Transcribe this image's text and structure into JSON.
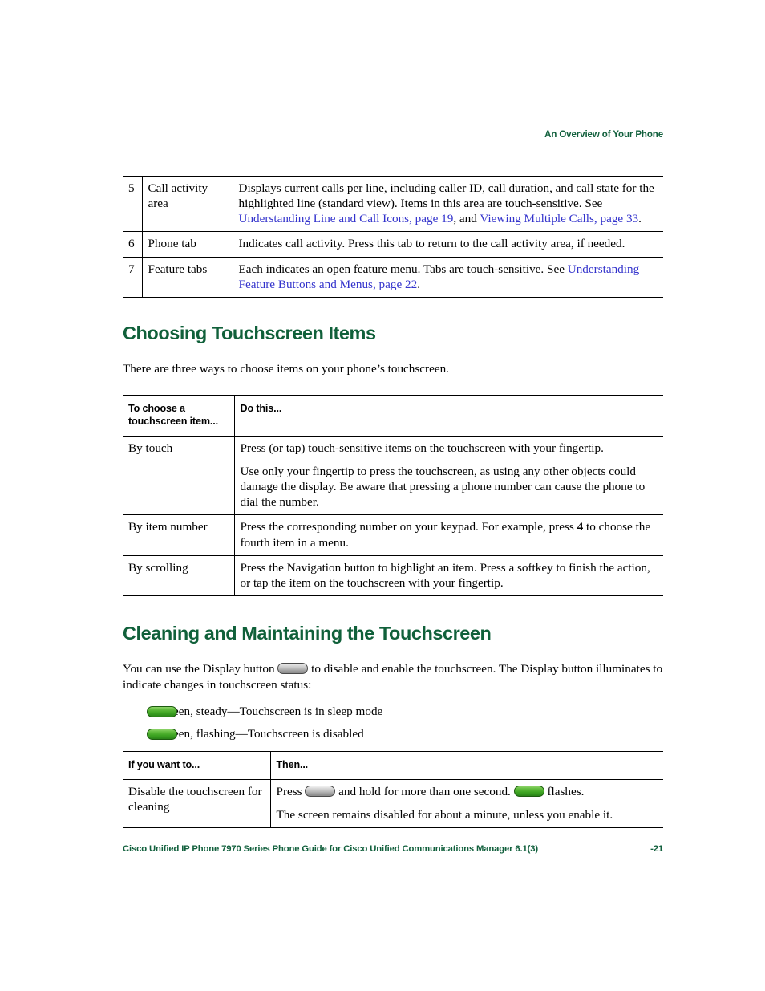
{
  "header": {
    "running_head": "An Overview of Your Phone"
  },
  "table_overview": {
    "rows": [
      {
        "number": "5",
        "label": "Call activity area",
        "description_parts": [
          {
            "type": "text",
            "value": "Displays current calls per line, including caller ID, call duration, and call state for the highlighted line (standard view). Items in this area are touch-sensitive. See "
          },
          {
            "type": "link",
            "value": "Understanding Line and Call Icons, page 19"
          },
          {
            "type": "text",
            "value": ", and "
          },
          {
            "type": "link",
            "value": "Viewing Multiple Calls, page 33"
          },
          {
            "type": "text",
            "value": "."
          }
        ]
      },
      {
        "number": "6",
        "label": "Phone tab",
        "description_parts": [
          {
            "type": "text",
            "value": "Indicates call activity. Press this tab to return to the call activity area, if needed."
          }
        ]
      },
      {
        "number": "7",
        "label": "Feature tabs",
        "description_parts": [
          {
            "type": "text",
            "value": "Each indicates an open feature menu. Tabs are touch-sensitive. See "
          },
          {
            "type": "link",
            "value": "Understanding Feature Buttons and Menus, page 22"
          },
          {
            "type": "text",
            "value": "."
          }
        ]
      }
    ],
    "row5_desc_text": "Displays current calls per line, including caller ID, call duration, and call state for the highlighted line (standard view). Items in this area are touch-sensitive. See ",
    "row5_link1": "Understanding Line and Call Icons, page 19",
    "row5_mid": ", and ",
    "row5_link2": "Viewing Multiple Calls, page 33",
    "row5_end": ".",
    "row6_desc": "Indicates call activity. Press this tab to return to the call activity area, if needed.",
    "row7_desc_text": "Each indicates an open feature menu. Tabs are touch-sensitive. See ",
    "row7_link1": "Understanding Feature Buttons and Menus, page 22",
    "row7_end": "."
  },
  "section_choosing": {
    "heading": "Choosing Touchscreen Items",
    "intro": "There are three ways to choose items on your phone’s touchscreen.",
    "table": {
      "header_col1": "To choose a touchscreen item...",
      "header_col2": "Do this...",
      "rows": [
        {
          "method": "By touch",
          "para1": "Press (or tap) touch-sensitive items on the touchscreen with your fingertip.",
          "para2": "Use only your fingertip to press the touchscreen, as using any other objects could damage the display. Be aware that pressing a phone number can cause the phone to dial the number."
        },
        {
          "method": "By item number",
          "para1_pre": "Press the corresponding number on your keypad. For example, press ",
          "para1_bold": "4",
          "para1_post": " to choose the fourth item in a menu."
        },
        {
          "method": "By scrolling",
          "para1": "Press the Navigation button to highlight an item. Press a softkey to finish the action, or tap the item on the touchscreen with your fingertip."
        }
      ]
    }
  },
  "section_cleaning": {
    "heading": "Cleaning and Maintaining the Touchscreen",
    "intro_pre": "You can use the Display button ",
    "intro_post": " to disable and enable the touchscreen. The Display button illuminates to indicate changes in touchscreen status:",
    "status_items": [
      {
        "icon": "green-pill-icon",
        "text": "Green, steady—Touchscreen is in sleep mode"
      },
      {
        "icon": "green-pill-icon",
        "text": "Green, flashing—Touchscreen is disabled"
      }
    ],
    "table": {
      "header_col1": "If you want to...",
      "header_col2": "Then...",
      "row": {
        "want_to": "Disable the touchscreen for cleaning",
        "then_pre": "Press ",
        "then_mid": " and hold for more than one second. ",
        "then_post": " flashes.",
        "then_para2": "The screen remains disabled for about a minute, unless you enable it."
      }
    }
  },
  "footer": {
    "left": "Cisco Unified IP Phone 7970 Series Phone Guide for Cisco Unified Communications Manager 6.1(3)",
    "right": "-21"
  },
  "colors": {
    "heading_green": "#10603A",
    "link_blue": "#3333CC",
    "pill_green": "#3FA523",
    "pill_gray": "#B9B9B9"
  }
}
